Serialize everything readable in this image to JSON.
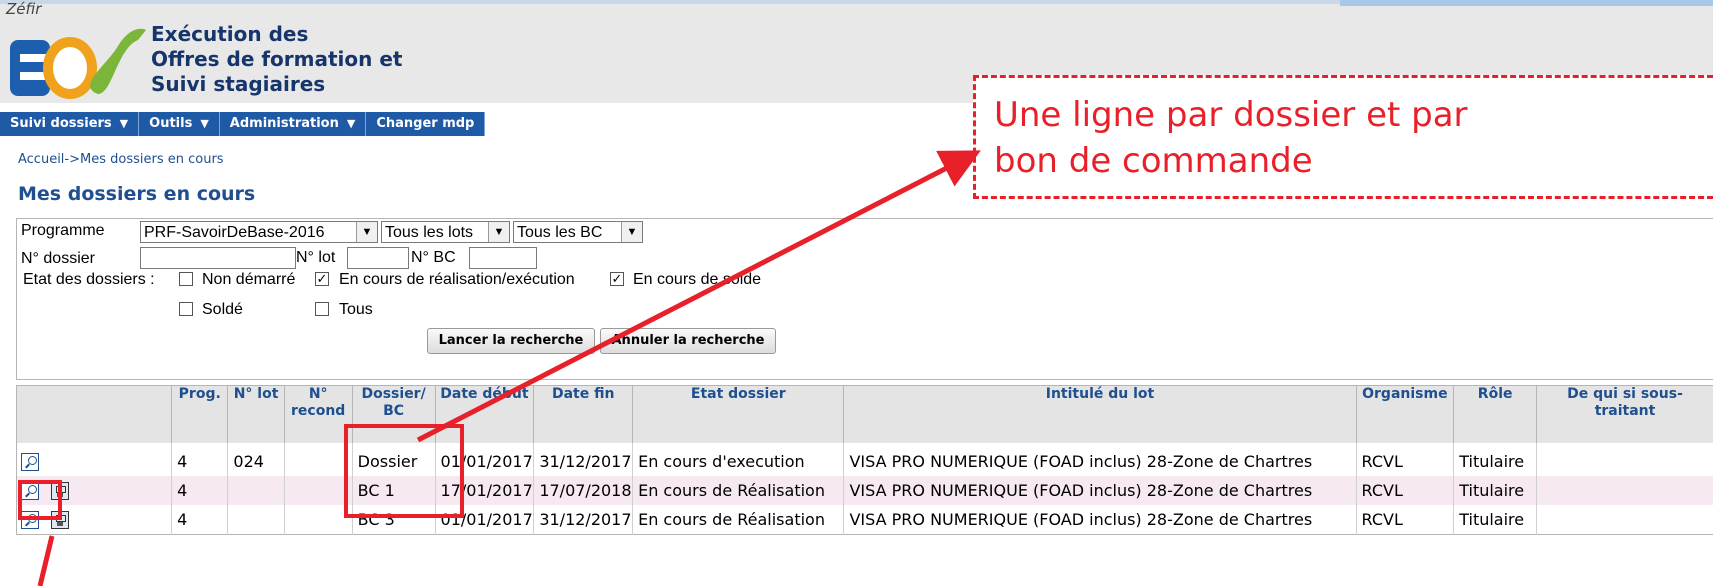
{
  "app": {
    "brand": "Zéfir",
    "logo_letters": "EOS",
    "title_lines": [
      "Exécution des",
      "Offres de formation et",
      "Suivi stagiaires"
    ]
  },
  "nav": {
    "items": [
      {
        "label": "Suivi dossiers",
        "caret": true
      },
      {
        "label": "Outils",
        "caret": true
      },
      {
        "label": "Administration",
        "caret": true
      },
      {
        "label": "Changer mdp",
        "caret": false
      }
    ]
  },
  "breadcrumb": "Accueil->Mes dossiers en cours",
  "page_title": "Mes dossiers en cours",
  "filters": {
    "programme_label": "Programme",
    "programme_value": "PRF-SavoirDeBase-2016",
    "lot_select": "Tous les lots",
    "bc_select": "Tous les BC",
    "dossier_label": "N° dossier",
    "lot_label": "N° lot",
    "bc_label": "N° BC",
    "etat_label": "Etat des dossiers :",
    "checks": [
      {
        "label": "Non démarré",
        "checked": false
      },
      {
        "label": "En cours de réalisation/exécution",
        "checked": true
      },
      {
        "label": "En cours de solde",
        "checked": true
      },
      {
        "label": "Soldé",
        "checked": false
      },
      {
        "label": "Tous",
        "checked": false
      }
    ],
    "search_button": "Lancer la recherche",
    "cancel_button": "Annuler la recherche"
  },
  "table": {
    "headers": [
      "Prog.",
      "N° lot",
      "N° recond",
      "Dossier/ BC",
      "Date début",
      "Date fin",
      "Etat dossier",
      "Intitulé du lot",
      "Organisme",
      "Rôle",
      "De qui si sous-traitant"
    ],
    "rows": [
      {
        "prog": "4",
        "lot": "024",
        "recond": "",
        "dossier": "Dossier",
        "debut": "01/01/2017",
        "fin": "31/12/2017",
        "etat": "En cours d'execution",
        "intitule": "VISA PRO NUMERIQUE (FOAD inclus) 28-Zone de Chartres",
        "organisme": "RCVL",
        "role": "Titulaire",
        "sous_traitant": "",
        "icons": [
          "magnifier-icon"
        ]
      },
      {
        "prog": "4",
        "lot": "",
        "recond": "",
        "dossier": "BC 1",
        "debut": "17/01/2017",
        "fin": "17/07/2018",
        "etat": "En cours de Réalisation",
        "intitule": "VISA PRO NUMERIQUE (FOAD inclus) 28-Zone de Chartres",
        "organisme": "RCVL",
        "role": "Titulaire",
        "sous_traitant": "",
        "icons": [
          "magnifier-icon",
          "document-icon"
        ]
      },
      {
        "prog": "4",
        "lot": "",
        "recond": "",
        "dossier": "BC 3",
        "debut": "01/01/2017",
        "fin": "31/12/2017",
        "etat": "En cours de Réalisation",
        "intitule": "VISA PRO NUMERIQUE (FOAD inclus) 28-Zone de Chartres",
        "organisme": "RCVL",
        "role": "Titulaire",
        "sous_traitant": "",
        "icons": [
          "magnifier-icon",
          "document-icon"
        ]
      }
    ]
  },
  "annotation": {
    "callout_lines": [
      "Une ligne par dossier et par",
      "bon de commande"
    ],
    "color": "#e8202a"
  },
  "colors": {
    "nav_bg": "#1f5aa6",
    "title_blue": "#1f4f8f",
    "alt_row": "#f6e9f2"
  }
}
